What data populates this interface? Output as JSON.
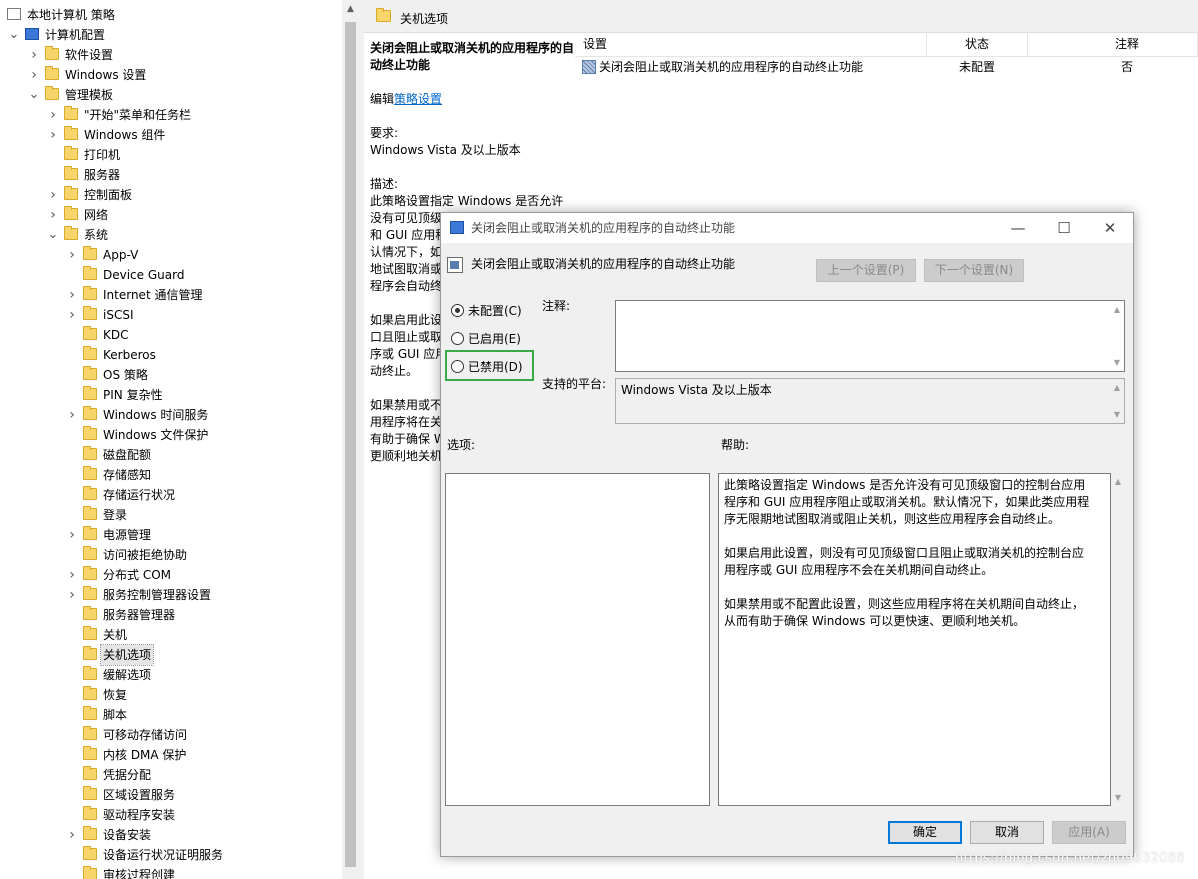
{
  "tree": {
    "root": "本地计算机 策略",
    "items": [
      {
        "label": "计算机配置",
        "level": 1,
        "expander": "open",
        "icon": "computer-icon"
      },
      {
        "label": "软件设置",
        "level": 2,
        "expander": "closed",
        "icon": "folder-icon"
      },
      {
        "label": "Windows 设置",
        "level": 2,
        "expander": "closed",
        "icon": "folder-icon"
      },
      {
        "label": "管理模板",
        "level": 2,
        "expander": "open",
        "icon": "folder-icon"
      },
      {
        "label": "\"开始\"菜单和任务栏",
        "level": 3,
        "expander": "closed",
        "icon": "folder-icon"
      },
      {
        "label": "Windows 组件",
        "level": 3,
        "expander": "closed",
        "icon": "folder-icon"
      },
      {
        "label": "打印机",
        "level": 3,
        "expander": "none",
        "icon": "folder-icon"
      },
      {
        "label": "服务器",
        "level": 3,
        "expander": "none",
        "icon": "folder-icon"
      },
      {
        "label": "控制面板",
        "level": 3,
        "expander": "closed",
        "icon": "folder-icon"
      },
      {
        "label": "网络",
        "level": 3,
        "expander": "closed",
        "icon": "folder-icon"
      },
      {
        "label": "系统",
        "level": 3,
        "expander": "open",
        "icon": "folder-icon"
      },
      {
        "label": "App-V",
        "level": 4,
        "expander": "closed",
        "icon": "folder-icon"
      },
      {
        "label": "Device Guard",
        "level": 4,
        "expander": "none",
        "icon": "folder-icon"
      },
      {
        "label": "Internet 通信管理",
        "level": 4,
        "expander": "closed",
        "icon": "folder-icon"
      },
      {
        "label": "iSCSI",
        "level": 4,
        "expander": "closed",
        "icon": "folder-icon"
      },
      {
        "label": "KDC",
        "level": 4,
        "expander": "none",
        "icon": "folder-icon"
      },
      {
        "label": "Kerberos",
        "level": 4,
        "expander": "none",
        "icon": "folder-icon"
      },
      {
        "label": "OS 策略",
        "level": 4,
        "expander": "none",
        "icon": "folder-icon"
      },
      {
        "label": "PIN 复杂性",
        "level": 4,
        "expander": "none",
        "icon": "folder-icon"
      },
      {
        "label": "Windows 时间服务",
        "level": 4,
        "expander": "closed",
        "icon": "folder-icon"
      },
      {
        "label": "Windows 文件保护",
        "level": 4,
        "expander": "none",
        "icon": "folder-icon"
      },
      {
        "label": "磁盘配额",
        "level": 4,
        "expander": "none",
        "icon": "folder-icon"
      },
      {
        "label": "存储感知",
        "level": 4,
        "expander": "none",
        "icon": "folder-icon"
      },
      {
        "label": "存储运行状况",
        "level": 4,
        "expander": "none",
        "icon": "folder-icon"
      },
      {
        "label": "登录",
        "level": 4,
        "expander": "none",
        "icon": "folder-icon"
      },
      {
        "label": "电源管理",
        "level": 4,
        "expander": "closed",
        "icon": "folder-icon"
      },
      {
        "label": "访问被拒绝协助",
        "level": 4,
        "expander": "none",
        "icon": "folder-icon"
      },
      {
        "label": "分布式 COM",
        "level": 4,
        "expander": "closed",
        "icon": "folder-icon"
      },
      {
        "label": "服务控制管理器设置",
        "level": 4,
        "expander": "closed",
        "icon": "folder-icon"
      },
      {
        "label": "服务器管理器",
        "level": 4,
        "expander": "none",
        "icon": "folder-icon"
      },
      {
        "label": "关机",
        "level": 4,
        "expander": "none",
        "icon": "folder-icon"
      },
      {
        "label": "关机选项",
        "level": 4,
        "expander": "none",
        "icon": "folder-icon",
        "selected": true
      },
      {
        "label": "缓解选项",
        "level": 4,
        "expander": "none",
        "icon": "folder-icon"
      },
      {
        "label": "恢复",
        "level": 4,
        "expander": "none",
        "icon": "folder-icon"
      },
      {
        "label": "脚本",
        "level": 4,
        "expander": "none",
        "icon": "folder-icon"
      },
      {
        "label": "可移动存储访问",
        "level": 4,
        "expander": "none",
        "icon": "folder-icon"
      },
      {
        "label": "内核 DMA 保护",
        "level": 4,
        "expander": "none",
        "icon": "folder-icon"
      },
      {
        "label": "凭据分配",
        "level": 4,
        "expander": "none",
        "icon": "folder-icon"
      },
      {
        "label": "区域设置服务",
        "level": 4,
        "expander": "none",
        "icon": "folder-icon"
      },
      {
        "label": "驱动程序安装",
        "level": 4,
        "expander": "none",
        "icon": "folder-icon"
      },
      {
        "label": "设备安装",
        "level": 4,
        "expander": "closed",
        "icon": "folder-icon"
      },
      {
        "label": "设备运行状况证明服务",
        "level": 4,
        "expander": "none",
        "icon": "folder-icon"
      },
      {
        "label": "审核过程创建",
        "level": 4,
        "expander": "none",
        "icon": "folder-icon"
      }
    ]
  },
  "pane": {
    "header_title": "关机选项",
    "desc_title": "关闭会阻止或取消关机的应用程序的自动终止功能",
    "edit_prefix": "编辑",
    "edit_link": "策略设置",
    "req_label": "要求:",
    "req_value": "Windows Vista 及以上版本",
    "desc_label": "描述:",
    "desc_lines_1": [
      "此策略设置指定 Windows 是否允许",
      "没有可见顶级",
      "和 GUI 应用程",
      "认情况下，如",
      "地试图取消或",
      "程序会自动终"
    ],
    "desc_lines_2": [
      "如果启用此设",
      "口且阻止或取",
      "序或 GUI 应用",
      "动终止。"
    ],
    "desc_lines_3": [
      "如果禁用或不",
      "用程序将在关",
      "有助于确保 W",
      "更顺利地关机"
    ]
  },
  "list": {
    "col_setting": "设置",
    "col_state": "状态",
    "col_note": "注释",
    "rows": [
      {
        "setting": "关闭会阻止或取消关机的应用程序的自动终止功能",
        "state": "未配置",
        "note": "否"
      }
    ]
  },
  "dialog": {
    "title": "关闭会阻止或取消关机的应用程序的自动终止功能",
    "policy_name": "关闭会阻止或取消关机的应用程序的自动终止功能",
    "prev_btn": "上一个设置(P)",
    "next_btn": "下一个设置(N)",
    "radio_not_configured": "未配置(C)",
    "radio_enabled": "已启用(E)",
    "radio_disabled": "已禁用(D)",
    "selected_radio": "not_configured",
    "comment_label": "注释:",
    "comment_value": "",
    "platform_label": "支持的平台:",
    "platform_value": "Windows Vista 及以上版本",
    "options_label": "选项:",
    "help_label": "帮助:",
    "help_paragraphs": [
      "此策略设置指定 Windows 是否允许没有可见顶级窗口的控制台应用程序和 GUI 应用程序阻止或取消关机。默认情况下，如果此类应用程序无限期地试图取消或阻止关机，则这些应用程序会自动终止。",
      "如果启用此设置，则没有可见顶级窗口且阻止或取消关机的控制台应用程序或 GUI 应用程序不会在关机期间自动终止。",
      "如果禁用或不配置此设置，则这些应用程序将在关机期间自动终止，从而有助于确保 Windows 可以更快速、更顺利地关机。"
    ],
    "ok_btn": "确定",
    "cancel_btn": "取消",
    "apply_btn": "应用(A)",
    "highlight_color": "#3aa94a",
    "focus_color": "#0078d7"
  },
  "watermark": "https://blog.csdn.net/zb09932088"
}
